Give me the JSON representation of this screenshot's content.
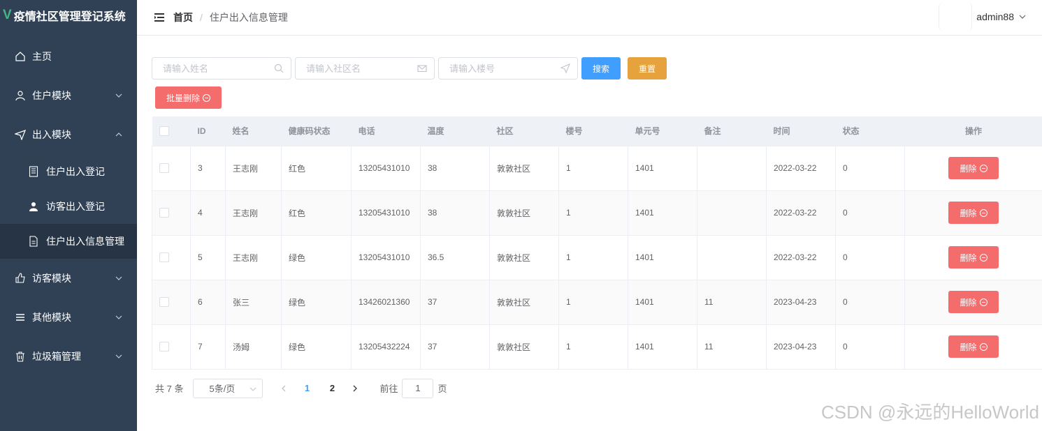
{
  "sidebar": {
    "logo_glyph": "V",
    "title": "疫情社区管理登记系统",
    "items": [
      {
        "label": "主页",
        "icon": "home-icon"
      },
      {
        "label": "住户模块",
        "icon": "user-icon"
      },
      {
        "label": "出入模块",
        "icon": "send-icon",
        "sub": [
          {
            "label": "住户出入登记",
            "icon": "notebook-icon"
          },
          {
            "label": "访客出入登记",
            "icon": "user-solid-icon"
          },
          {
            "label": "住户出入信息管理",
            "icon": "document-icon",
            "active": true
          }
        ]
      },
      {
        "label": "访客模块",
        "icon": "thumb-icon"
      },
      {
        "label": "其他模块",
        "icon": "list-icon"
      },
      {
        "label": "垃圾箱管理",
        "icon": "delete-icon"
      }
    ]
  },
  "header": {
    "breadcrumb_home": "首页",
    "breadcrumb_sep": "/",
    "breadcrumb_current": "住户出入信息管理",
    "username": "admin88"
  },
  "search": {
    "name_placeholder": "请输入姓名",
    "community_placeholder": "请输入社区名",
    "building_placeholder": "请输入楼号",
    "search_label": "搜索",
    "reset_label": "重置",
    "batch_delete_label": "批量删除"
  },
  "table": {
    "headers": [
      "ID",
      "姓名",
      "健康码状态",
      "电话",
      "温度",
      "社区",
      "楼号",
      "单元号",
      "备注",
      "时间",
      "状态",
      "操作"
    ],
    "delete_label": "删除",
    "rows": [
      {
        "id": "3",
        "name": "王志刚",
        "health": "红色",
        "phone": "13205431010",
        "temp": "38",
        "community": "敦敦社区",
        "building": "1",
        "unit": "1401",
        "note": "",
        "time": "2022-03-22",
        "status": "0"
      },
      {
        "id": "4",
        "name": "王志刚",
        "health": "红色",
        "phone": "13205431010",
        "temp": "38",
        "community": "敦敦社区",
        "building": "1",
        "unit": "1401",
        "note": "",
        "time": "2022-03-22",
        "status": "0"
      },
      {
        "id": "5",
        "name": "王志刚",
        "health": "绿色",
        "phone": "13205431010",
        "temp": "36.5",
        "community": "敦敦社区",
        "building": "1",
        "unit": "1401",
        "note": "",
        "time": "2022-03-22",
        "status": "0"
      },
      {
        "id": "6",
        "name": "张三",
        "health": "绿色",
        "phone": "13426021360",
        "temp": "37",
        "community": "敦敦社区",
        "building": "1",
        "unit": "1401",
        "note": "11",
        "time": "2023-04-23",
        "status": "0"
      },
      {
        "id": "7",
        "name": "汤姆",
        "health": "绿色",
        "phone": "13205432224",
        "temp": "37",
        "community": "敦敦社区",
        "building": "1",
        "unit": "1401",
        "note": "11",
        "time": "2023-04-23",
        "status": "0"
      }
    ]
  },
  "pagination": {
    "total_text": "共 7 条",
    "page_size": "5条/页",
    "pages": [
      "1",
      "2"
    ],
    "current_page": "1",
    "goto_prefix": "前往",
    "goto_value": "1",
    "goto_suffix": "页"
  },
  "watermark": "CSDN @永远的HelloWorld",
  "colors": {
    "sidebar_bg": "#304156",
    "primary": "#409eff",
    "warning": "#e6a23c",
    "danger": "#f56c6c",
    "logo": "#41b883"
  }
}
